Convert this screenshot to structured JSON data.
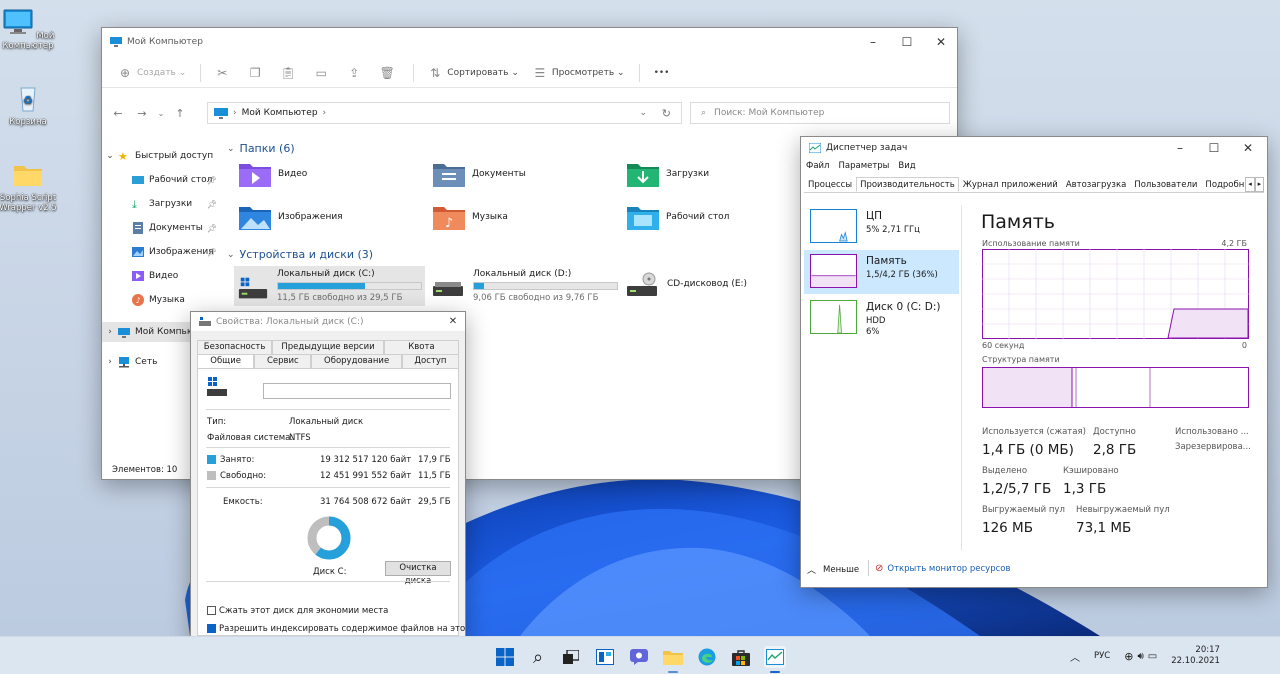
{
  "desktop": {
    "icons": [
      {
        "label": "Мой Компьютер",
        "icon": "computer-icon"
      },
      {
        "label": "Корзина",
        "icon": "recycle-bin-icon"
      },
      {
        "label": "Sophia Script Wrapper v2.5",
        "icon": "folder-icon"
      }
    ]
  },
  "explorer": {
    "title": "Мой Компьютер",
    "toolbar": {
      "create": "Создать",
      "sort": "Сортировать",
      "view": "Просмотреть",
      "more": "•••"
    },
    "address": {
      "path": "Мой Компьютер"
    },
    "search": {
      "placeholder": "Поиск: Мой Компьютер"
    },
    "nav": {
      "quick_access": "Быстрый доступ",
      "items": [
        {
          "label": "Рабочий стол",
          "pinned": true
        },
        {
          "label": "Загрузки",
          "pinned": true
        },
        {
          "label": "Документы",
          "pinned": true
        },
        {
          "label": "Изображения",
          "pinned": true
        },
        {
          "label": "Видео",
          "pinned": false
        },
        {
          "label": "Музыка",
          "pinned": false
        }
      ],
      "this_pc": "Мой Компьютер",
      "network": "Сеть"
    },
    "folders_header": "Папки (6)",
    "folders": [
      {
        "label": "Видео",
        "color": "#8b5cf6"
      },
      {
        "label": "Документы",
        "color": "#5b7ea6"
      },
      {
        "label": "Загрузки",
        "color": "#1aa56c"
      },
      {
        "label": "Изображения",
        "color": "#2a7bd1"
      },
      {
        "label": "Музыка",
        "color": "#e8734a"
      },
      {
        "label": "Рабочий стол",
        "color": "#2a9fd6"
      }
    ],
    "drives_header": "Устройства и диски (3)",
    "drives": [
      {
        "label": "Локальный диск (C:)",
        "free": "11,5 ГБ свободно из 29,5 ГБ",
        "used_fraction": 0.61
      },
      {
        "label": "Локальный диск (D:)",
        "free": "9,06 ГБ свободно из 9,76 ГБ",
        "used_fraction": 0.07
      },
      {
        "label": "CD-дисковод (E:)",
        "free": "",
        "used_fraction": null
      }
    ],
    "status": "Элементов: 10"
  },
  "properties": {
    "title": "Свойства: Локальный диск (C:)",
    "tabs_row1": [
      "Безопасность",
      "Предыдущие версии",
      "Квота"
    ],
    "tabs_row2": [
      "Общие",
      "Сервис",
      "Оборудование",
      "Доступ"
    ],
    "name_value": "",
    "type_label": "Тип:",
    "type_value": "Локальный диск",
    "fs_label": "Файловая система:",
    "fs_value": "NTFS",
    "used_label": "Занято:",
    "used_bytes": "19 312 517 120 байт",
    "used_gb": "17,9 ГБ",
    "free_label": "Свободно:",
    "free_bytes": "12 451 991 552 байт",
    "free_gb": "11,5 ГБ",
    "capacity_label": "Емкость:",
    "capacity_bytes": "31 764 508 672 байт",
    "capacity_gb": "29,5 ГБ",
    "disk_label": "Диск C:",
    "cleanup_button": "Очистка диска",
    "compress_label": "Сжать этот диск для экономии места",
    "compress_checked": false,
    "index_label": "Разрешить индексировать содержимое файлов на этом",
    "index_checked": true,
    "used_color": "#26a0da",
    "free_color": "#bebebe"
  },
  "taskmgr": {
    "title": "Диспетчер задач",
    "menu": [
      "Файл",
      "Параметры",
      "Вид"
    ],
    "tabs": [
      "Процессы",
      "Производительность",
      "Журнал приложений",
      "Автозагрузка",
      "Пользователи",
      "Подробно"
    ],
    "active_tab": 1,
    "side": [
      {
        "name": "ЦП",
        "detail": "5% 2,71 ГГц",
        "detail2": ""
      },
      {
        "name": "Память",
        "detail": "1,5/4,2 ГБ (36%)",
        "detail2": ""
      },
      {
        "name": "Диск 0 (C: D:)",
        "detail": "HDD",
        "detail2": "6%"
      }
    ],
    "main_title": "Память",
    "usage_label": "Использование памяти",
    "usage_max": "4,2 ГБ",
    "time_label": "60 секунд",
    "zero_label": "0",
    "structure_label": "Структура памяти",
    "stats": [
      {
        "label": "Используется (сжатая)",
        "value": "1,4 ГБ (0 МБ)"
      },
      {
        "label": "Доступно",
        "value": "2,8 ГБ"
      },
      {
        "label": "Использовано ...",
        "value": ""
      },
      {
        "label": "Зарезервирова...",
        "value": ""
      },
      {
        "label": "Выделено",
        "value": "1,2/5,7 ГБ"
      },
      {
        "label": "Кэшировано",
        "value": "1,3 ГБ"
      },
      {
        "label": "Выгружаемый пул",
        "value": "126 МБ"
      },
      {
        "label": "Невыгружаемый пул",
        "value": "73,1 МБ"
      }
    ],
    "less_label": "Меньше",
    "monitor_link": "Открыть монитор ресурсов",
    "accent": "#8b12ae"
  },
  "taskbar": {
    "lang": "РУС",
    "time": "20:17",
    "date": "22.10.2021"
  }
}
